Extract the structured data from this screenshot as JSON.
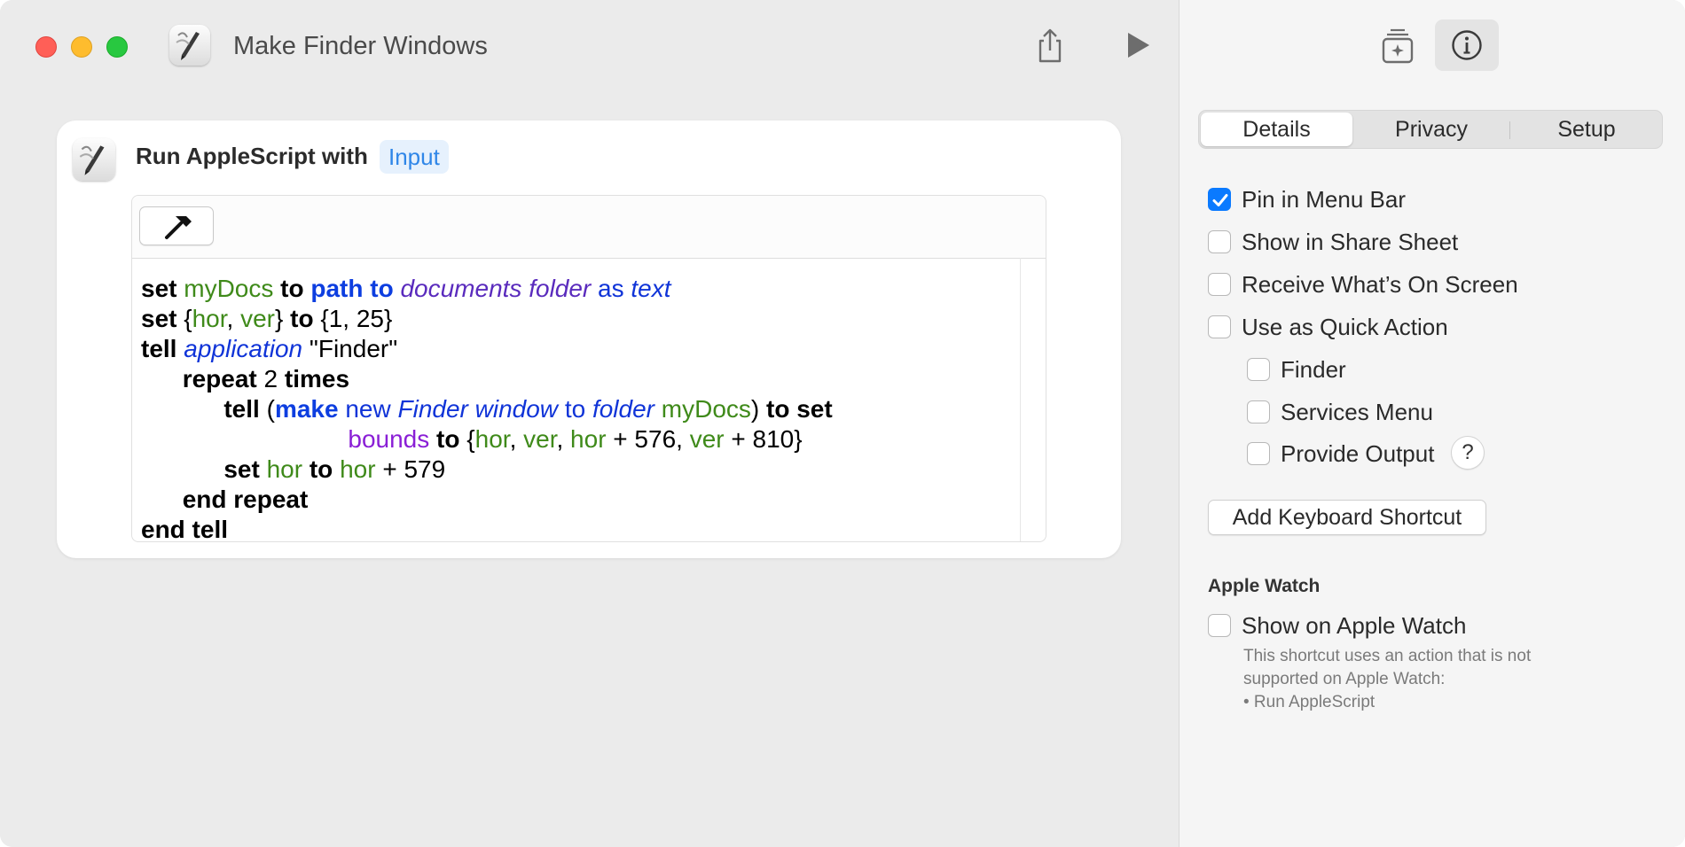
{
  "window": {
    "title": "Make Finder Windows"
  },
  "toolbar": {
    "share_icon": "share-icon",
    "run_icon": "play-icon",
    "library_icon": "add-to-library-icon",
    "info_icon": "info-icon"
  },
  "action": {
    "title": "Run AppleScript with",
    "input_pill": "Input",
    "compile_icon": "hammer-icon",
    "code_lines": [
      "set myDocs to path to documents folder as text",
      "set {hor, ver} to {1, 25}",
      "tell application \"Finder\"",
      "repeat 2 times",
      "tell (make new Finder window to folder myDocs) to set",
      "bounds to {hor, ver, hor + 576, ver + 810}",
      "set hor to hor + 579",
      "end repeat",
      "end tell"
    ]
  },
  "sidebar": {
    "tabs": [
      {
        "label": "Details",
        "active": true
      },
      {
        "label": "Privacy",
        "active": false
      },
      {
        "label": "Setup",
        "active": false
      }
    ],
    "options": [
      {
        "label": "Pin in Menu Bar",
        "checked": true
      },
      {
        "label": "Show in Share Sheet",
        "checked": false
      },
      {
        "label": "Receive What’s On Screen",
        "checked": false
      },
      {
        "label": "Use as Quick Action",
        "checked": false
      }
    ],
    "quick_action_options": [
      {
        "label": "Finder",
        "checked": false
      },
      {
        "label": "Services Menu",
        "checked": false
      },
      {
        "label": "Provide Output",
        "checked": false
      }
    ],
    "help_label": "?",
    "keyboard_shortcut_label": "Add Keyboard Shortcut",
    "apple_watch": {
      "heading": "Apple Watch",
      "option_label": "Show on Apple Watch",
      "option_checked": false,
      "note_line1": "This shortcut uses an action that is not",
      "note_line2": "supported on Apple Watch:",
      "note_line3": "• Run AppleScript"
    }
  },
  "colors": {
    "accent": "#0a7aff",
    "input_pill_text": "#2f86e8",
    "close": "#ff5f57",
    "minimize": "#febc2e",
    "zoom": "#28c840"
  }
}
